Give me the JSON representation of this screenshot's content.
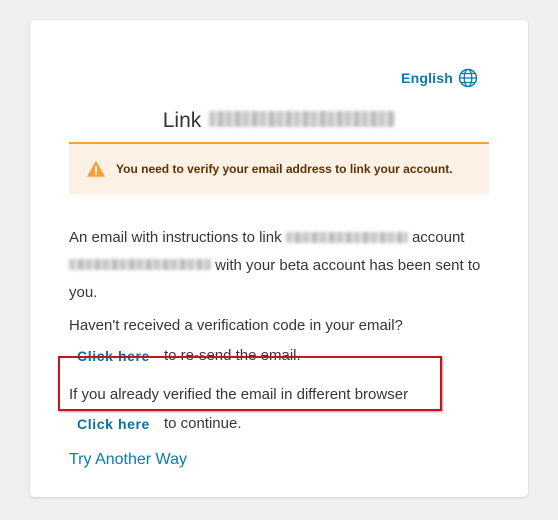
{
  "language": {
    "label": "English",
    "icon": "globe-icon"
  },
  "header": {
    "title_prefix": "Link"
  },
  "alert": {
    "icon": "warning-icon",
    "color": "#f0a23a",
    "text": "You need to verify your email address to link your account."
  },
  "body": {
    "para_part1": "An email with instructions to link",
    "para_part2": "account",
    "para_part3": "with your beta account has been sent to you.",
    "resend_question": "Haven't received a verification code in your email?",
    "resend_link": "Click here",
    "resend_suffix": "to re-send the email.",
    "already_verified": "If you already verified the email in different browser",
    "continue_link": "Click here",
    "continue_suffix": "to continue."
  },
  "footer": {
    "try_another": "Try Another Way"
  },
  "colors": {
    "link": "#0a7bb0",
    "highlight_border": "#c6141d",
    "alert_background": "#fdf0e5"
  }
}
